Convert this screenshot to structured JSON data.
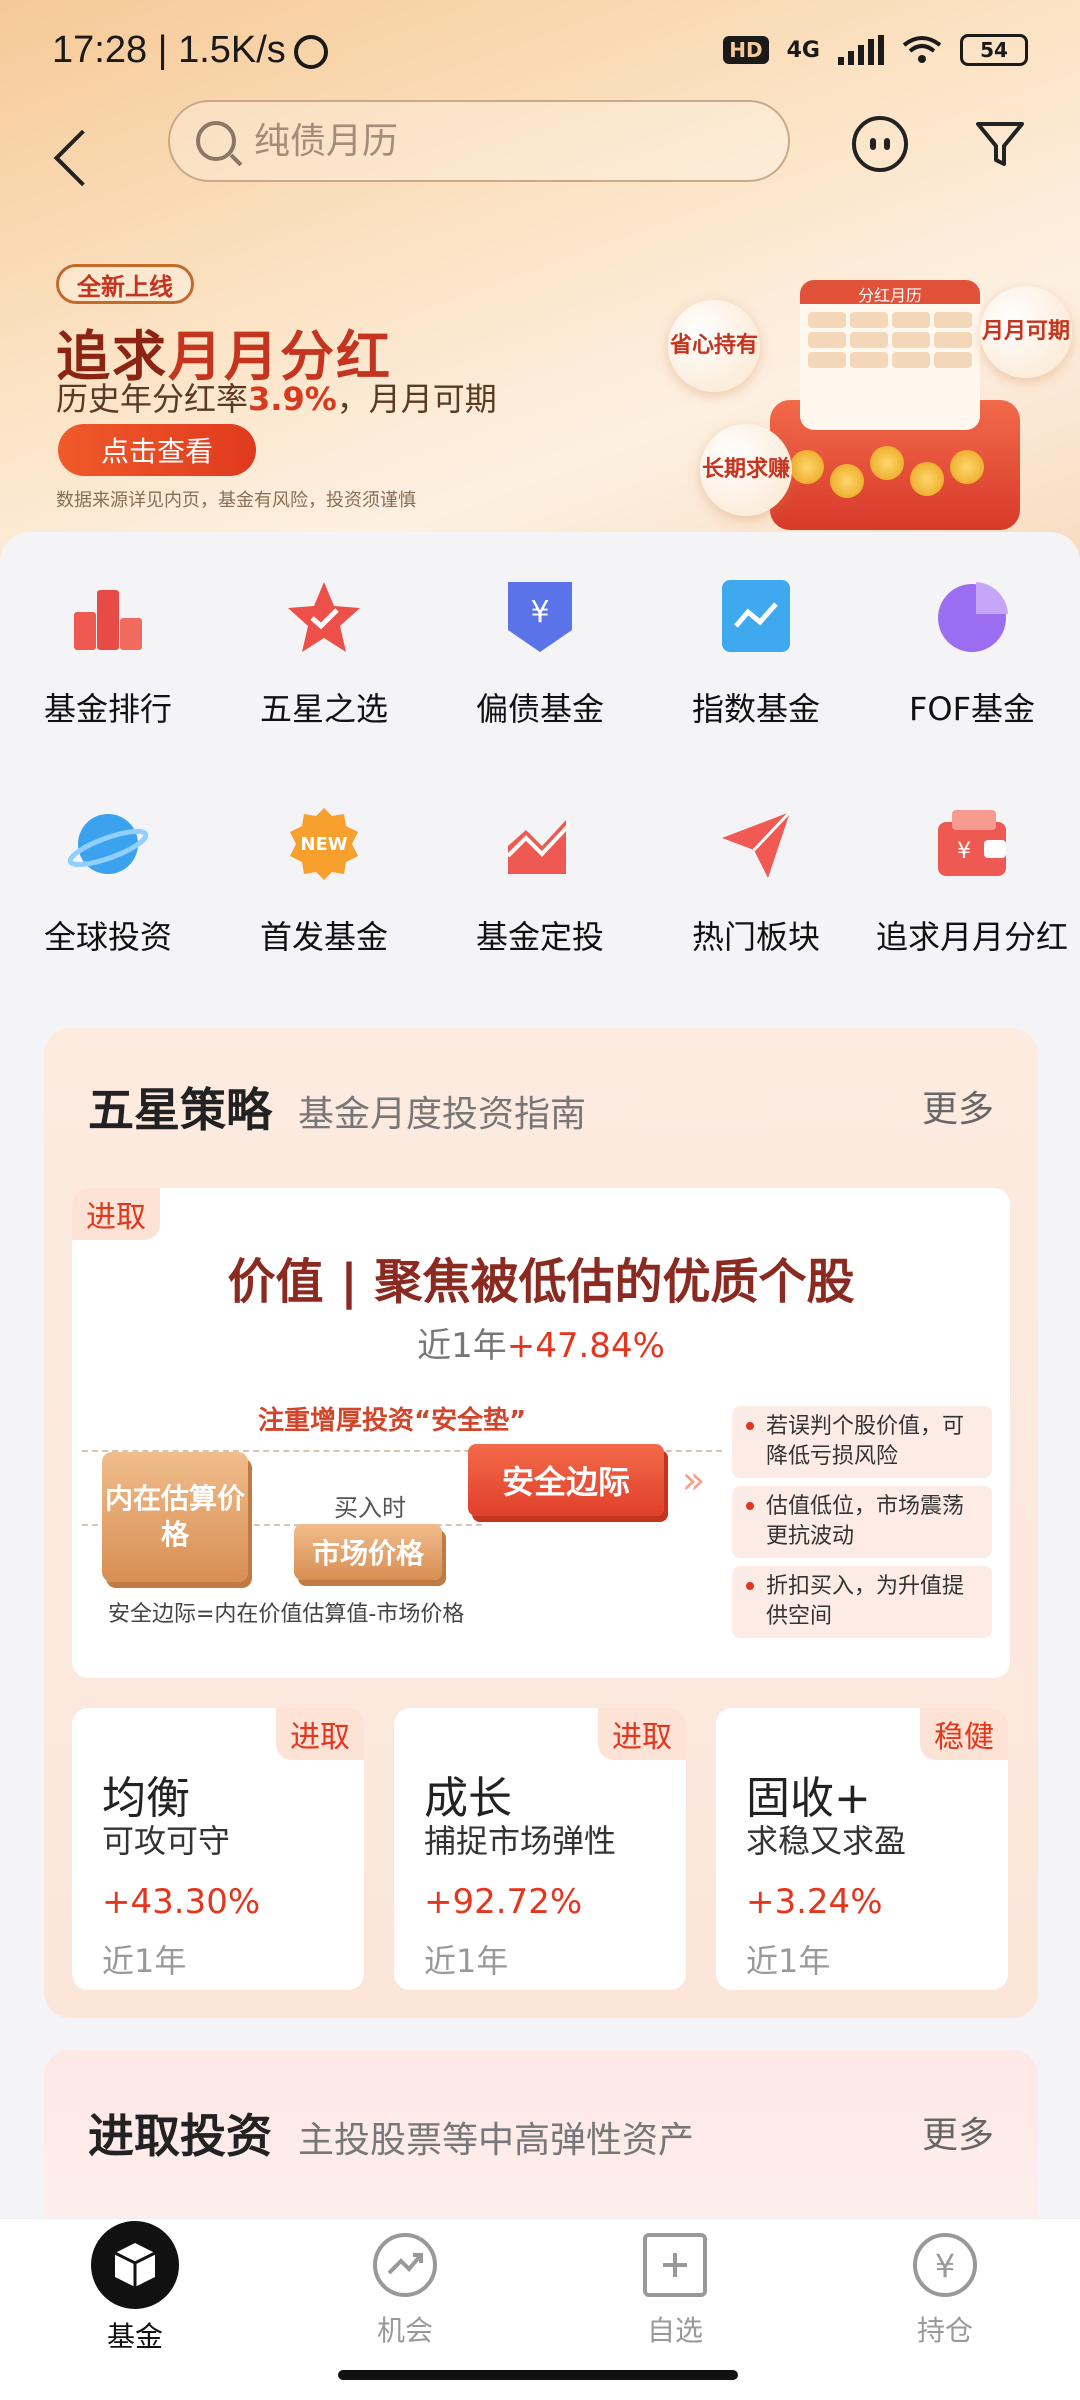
{
  "status_bar": {
    "time": "17:28 | 1.5K/s",
    "hd": "HD",
    "network": "4G",
    "battery": "54"
  },
  "search": {
    "placeholder": "纯债月历"
  },
  "banner": {
    "tag": "全新上线",
    "title_a": "追求",
    "title_b": "月月分红",
    "subtitle_a": "历史年分红率",
    "subtitle_rate": "3.9%",
    "subtitle_b": "，月月可期",
    "button": "点击查看",
    "note": "数据来源详见内页，基金有风险，投资须谨慎",
    "calendar_title": "分红月历",
    "bubbles": [
      "省心持有",
      "月月可期",
      "长期求赚"
    ]
  },
  "menu": [
    {
      "label": "基金排行",
      "icon": "podium-icon"
    },
    {
      "label": "五星之选",
      "icon": "star-icon"
    },
    {
      "label": "偏债基金",
      "icon": "yuan-shield-icon"
    },
    {
      "label": "指数基金",
      "icon": "chart-box-icon"
    },
    {
      "label": "FOF基金",
      "icon": "pie-icon"
    },
    {
      "label": "全球投资",
      "icon": "planet-icon"
    },
    {
      "label": "首发基金",
      "icon": "new-badge-icon"
    },
    {
      "label": "基金定投",
      "icon": "trend-up-icon"
    },
    {
      "label": "热门板块",
      "icon": "paper-plane-icon"
    },
    {
      "label": "追求月月分红",
      "icon": "wallet-icon"
    }
  ],
  "strategy": {
    "title": "五星策略",
    "subtitle": "基金月度投资指南",
    "more": "更多",
    "feature": {
      "tag": "进取",
      "title": "价值 | 聚焦被低估的优质个股",
      "period": "近1年",
      "return": "+47.84%",
      "diagram_note": "注重增厚投资“安全垫”",
      "box_intrinsic": "内在估算价格",
      "buy_label": "买入时",
      "box_market": "市场价格",
      "box_safe": "安全边际",
      "formula": "安全边际=内在价值估算值-市场价格",
      "points": [
        "若误判个股价值，可降低亏损风险",
        "估值低位，市场震荡更抗波动",
        "折扣买入，为升值提供空间"
      ]
    },
    "cards": [
      {
        "tag": "进取",
        "name": "均衡",
        "desc": "可攻可守",
        "return": "+43.30%",
        "period": "近1年"
      },
      {
        "tag": "进取",
        "name": "成长",
        "desc": "捕捉市场弹性",
        "return": "+92.72%",
        "period": "近1年"
      },
      {
        "tag": "稳健",
        "name": "固收+",
        "desc": "求稳又求盈",
        "return": "+3.24%",
        "period": "近1年"
      }
    ]
  },
  "aggressive": {
    "title": "进取投资",
    "subtitle": "主投股票等中高弹性资产",
    "more": "更多"
  },
  "tabs": [
    {
      "label": "基金",
      "active": true
    },
    {
      "label": "机会",
      "active": false
    },
    {
      "label": "自选",
      "active": false
    },
    {
      "label": "持仓",
      "active": false
    }
  ],
  "colors": {
    "accent_red": "#e4361e",
    "banner_red": "#c4341e",
    "header_gradient": "#f6c997"
  }
}
